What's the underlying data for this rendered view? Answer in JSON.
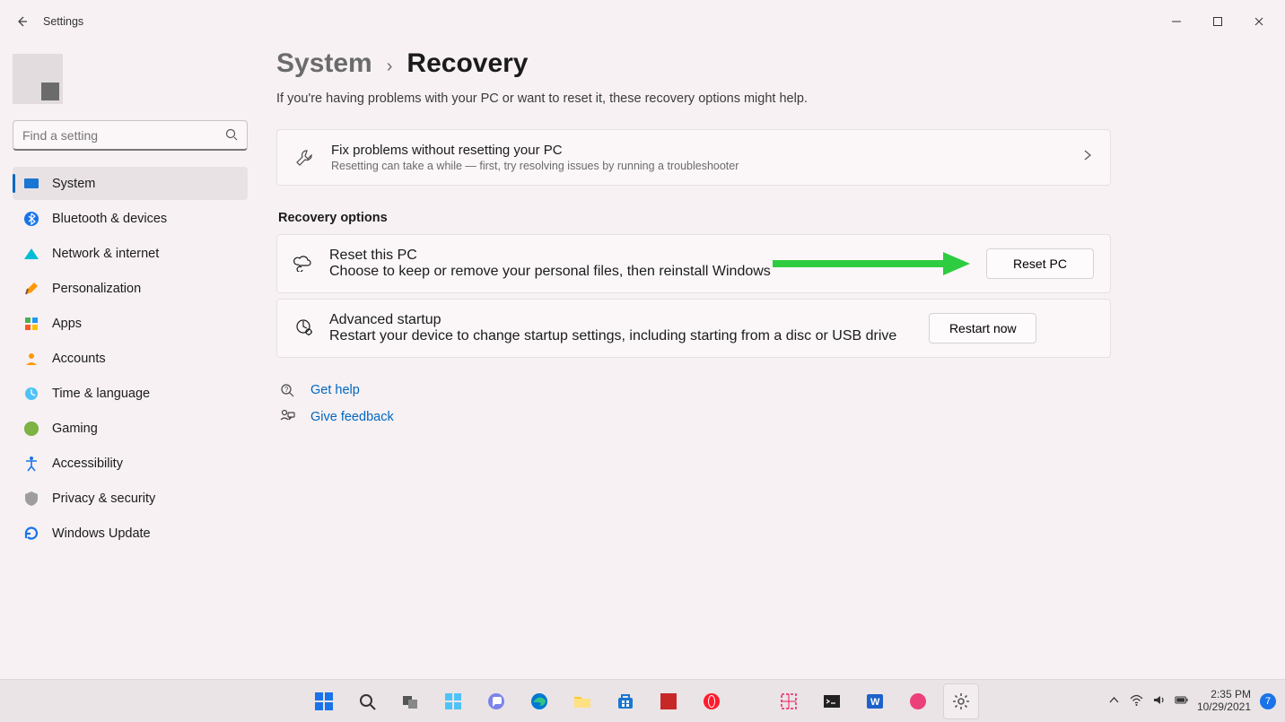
{
  "window": {
    "title": "Settings"
  },
  "search": {
    "placeholder": "Find a setting"
  },
  "sidebar": {
    "items": [
      {
        "label": "System"
      },
      {
        "label": "Bluetooth & devices"
      },
      {
        "label": "Network & internet"
      },
      {
        "label": "Personalization"
      },
      {
        "label": "Apps"
      },
      {
        "label": "Accounts"
      },
      {
        "label": "Time & language"
      },
      {
        "label": "Gaming"
      },
      {
        "label": "Accessibility"
      },
      {
        "label": "Privacy & security"
      },
      {
        "label": "Windows Update"
      }
    ]
  },
  "breadcrumb": {
    "parent": "System",
    "current": "Recovery"
  },
  "intro": "If you're having problems with your PC or want to reset it, these recovery options might help.",
  "fix_card": {
    "title": "Fix problems without resetting your PC",
    "subtitle": "Resetting can take a while — first, try resolving issues by running a troubleshooter"
  },
  "section_title": "Recovery options",
  "reset_card": {
    "title": "Reset this PC",
    "subtitle": "Choose to keep or remove your personal files, then reinstall Windows",
    "button": "Reset PC"
  },
  "advanced_card": {
    "title": "Advanced startup",
    "subtitle": "Restart your device to change startup settings, including starting from a disc or USB drive",
    "button": "Restart now"
  },
  "links": {
    "help": "Get help",
    "feedback": "Give feedback"
  },
  "tray": {
    "time": "2:35 PM",
    "date": "10/29/2021",
    "badge": "7"
  }
}
